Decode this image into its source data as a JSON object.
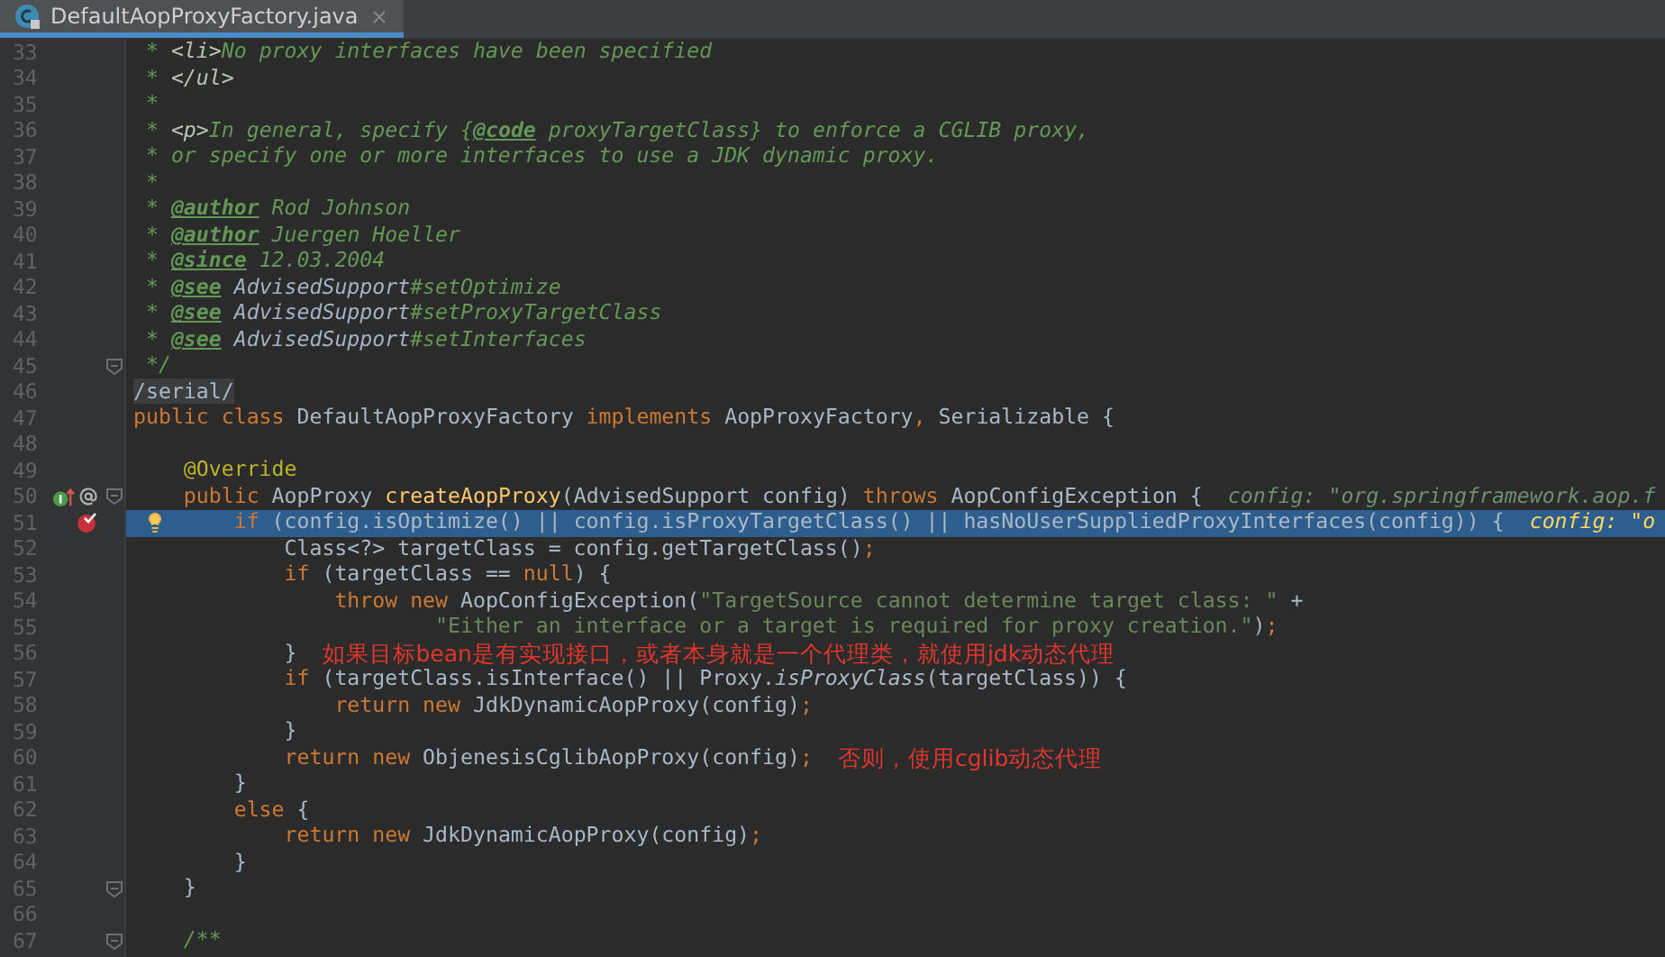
{
  "tab": {
    "title": "DefaultAopProxyFactory.java",
    "selected": true
  },
  "lines": [
    {
      "number": "33",
      "highlighted": false,
      "tokens": [
        {
          "text": " * ",
          "kind": "doc"
        },
        {
          "text": "<li>",
          "kind": "docmarkup"
        },
        {
          "text": "No proxy interfaces have been specified",
          "kind": "doc"
        }
      ]
    },
    {
      "number": "34",
      "highlighted": false,
      "tokens": [
        {
          "text": " * ",
          "kind": "doc"
        },
        {
          "text": "</ul>",
          "kind": "docmarkup"
        }
      ]
    },
    {
      "number": "35",
      "highlighted": false,
      "tokens": [
        {
          "text": " *",
          "kind": "doc"
        }
      ]
    },
    {
      "number": "36",
      "highlighted": false,
      "tokens": [
        {
          "text": " * ",
          "kind": "doc"
        },
        {
          "text": "<p>",
          "kind": "docmarkup"
        },
        {
          "text": "In general, specify {",
          "kind": "doc"
        },
        {
          "text": "@code",
          "kind": "doctag"
        },
        {
          "text": " proxyTargetClass} to enforce a CGLIB proxy,",
          "kind": "doc"
        }
      ]
    },
    {
      "number": "37",
      "highlighted": false,
      "tokens": [
        {
          "text": " * or specify one or more interfaces to use a JDK dynamic proxy.",
          "kind": "doc"
        }
      ]
    },
    {
      "number": "38",
      "highlighted": false,
      "tokens": [
        {
          "text": " *",
          "kind": "doc"
        }
      ]
    },
    {
      "number": "39",
      "highlighted": false,
      "tokens": [
        {
          "text": " * ",
          "kind": "doc"
        },
        {
          "text": "@author",
          "kind": "doctag"
        },
        {
          "text": " Rod Johnson",
          "kind": "doc"
        }
      ]
    },
    {
      "number": "40",
      "highlighted": false,
      "tokens": [
        {
          "text": " * ",
          "kind": "doc"
        },
        {
          "text": "@author",
          "kind": "doctag"
        },
        {
          "text": " Juergen Hoeller",
          "kind": "doc"
        }
      ]
    },
    {
      "number": "41",
      "highlighted": false,
      "tokens": [
        {
          "text": " * ",
          "kind": "doc"
        },
        {
          "text": "@since",
          "kind": "doctag"
        },
        {
          "text": " 12.03.2004",
          "kind": "doc"
        }
      ]
    },
    {
      "number": "42",
      "highlighted": false,
      "tokens": [
        {
          "text": " * ",
          "kind": "doc"
        },
        {
          "text": "@see",
          "kind": "doctag"
        },
        {
          "text": " AdvisedSupport",
          "kind": "docref"
        },
        {
          "text": "#setOptimize",
          "kind": "doc"
        }
      ]
    },
    {
      "number": "43",
      "highlighted": false,
      "tokens": [
        {
          "text": " * ",
          "kind": "doc"
        },
        {
          "text": "@see",
          "kind": "doctag"
        },
        {
          "text": " AdvisedSupport",
          "kind": "docref"
        },
        {
          "text": "#setProxyTargetClass",
          "kind": "doc"
        }
      ]
    },
    {
      "number": "44",
      "highlighted": false,
      "tokens": [
        {
          "text": " * ",
          "kind": "doc"
        },
        {
          "text": "@see",
          "kind": "doctag"
        },
        {
          "text": " AdvisedSupport",
          "kind": "docref"
        },
        {
          "text": "#setInterfaces",
          "kind": "doc"
        }
      ]
    },
    {
      "number": "45",
      "highlighted": false,
      "fold": true,
      "tokens": [
        {
          "text": " */",
          "kind": "doc"
        }
      ]
    },
    {
      "number": "46",
      "highlighted": false,
      "tokens": [
        {
          "text": "/serial/",
          "kind": "marked"
        }
      ]
    },
    {
      "number": "47",
      "highlighted": false,
      "tokens": [
        {
          "text": "public class",
          "kind": "kw"
        },
        {
          "text": " DefaultAopProxyFactory ",
          "kind": "plain"
        },
        {
          "text": "implements",
          "kind": "kw"
        },
        {
          "text": " AopProxyFactory",
          "kind": "plain"
        },
        {
          "text": ",",
          "kind": "kw"
        },
        {
          "text": " Serializable {",
          "kind": "plain"
        }
      ]
    },
    {
      "number": "48",
      "highlighted": false
    },
    {
      "number": "49",
      "highlighted": false,
      "tokens": [
        {
          "text": "    @Override",
          "kind": "anno"
        }
      ]
    },
    {
      "number": "50",
      "highlighted": false,
      "fold": true,
      "gutter": [
        {
          "kind": "implements"
        },
        {
          "kind": "annotated"
        }
      ],
      "tokens": [
        {
          "text": "    public",
          "kind": "kw"
        },
        {
          "text": " AopProxy ",
          "kind": "plain"
        },
        {
          "text": "createAopProxy",
          "kind": "method"
        },
        {
          "text": "(AdvisedSupport config) ",
          "kind": "plain"
        },
        {
          "text": "throws",
          "kind": "kw"
        },
        {
          "text": " AopConfigException {",
          "kind": "plain"
        }
      ],
      "hint": "config: \"org.springframework.aop.f"
    },
    {
      "number": "51",
      "highlighted": true,
      "intention_bulb": true,
      "gutter": [
        {
          "kind": "breakpoint"
        }
      ],
      "tokens": [
        {
          "text": "        if",
          "kind": "kw"
        },
        {
          "text": " (config.isOptimize() || config.isProxyTargetClass() || hasNoUserSuppliedProxyInterfaces(config)) {",
          "kind": "plain"
        }
      ],
      "hint": "config: \"o"
    },
    {
      "number": "52",
      "highlighted": false,
      "tokens": [
        {
          "text": "            Class<?> targetClass = config.getTargetClass()",
          "kind": "plain"
        },
        {
          "text": ";",
          "kind": "kw"
        }
      ]
    },
    {
      "number": "53",
      "highlighted": false,
      "tokens": [
        {
          "text": "            if",
          "kind": "kw"
        },
        {
          "text": " (targetClass == ",
          "kind": "plain"
        },
        {
          "text": "null",
          "kind": "kw"
        },
        {
          "text": ") {",
          "kind": "plain"
        }
      ]
    },
    {
      "number": "54",
      "highlighted": false,
      "tokens": [
        {
          "text": "                throw new",
          "kind": "kw"
        },
        {
          "text": " AopConfigException(",
          "kind": "plain"
        },
        {
          "text": "\"TargetSource cannot determine target class: \"",
          "kind": "str"
        },
        {
          "text": " +",
          "kind": "plain"
        }
      ]
    },
    {
      "number": "55",
      "highlighted": false,
      "tokens": [
        {
          "text": "                        \"Either an interface or a target is required for proxy creation.\"",
          "kind": "str"
        },
        {
          "text": ")",
          "kind": "plain"
        },
        {
          "text": ";",
          "kind": "kw"
        }
      ]
    },
    {
      "number": "56",
      "highlighted": false,
      "tokens": [
        {
          "text": "            }",
          "kind": "plain"
        }
      ],
      "note": "如果目标bean是有实现接口，或者本身就是一个代理类，就使用jdk动态代理"
    },
    {
      "number": "57",
      "highlighted": false,
      "tokens": [
        {
          "text": "            if",
          "kind": "kw"
        },
        {
          "text": " (targetClass.isInterface() || Proxy.",
          "kind": "plain"
        },
        {
          "text": "isProxyClass",
          "kind": "static"
        },
        {
          "text": "(targetClass)) {",
          "kind": "plain"
        }
      ]
    },
    {
      "number": "58",
      "highlighted": false,
      "tokens": [
        {
          "text": "                return new",
          "kind": "kw"
        },
        {
          "text": " JdkDynamicAopProxy(config)",
          "kind": "plain"
        },
        {
          "text": ";",
          "kind": "kw"
        }
      ]
    },
    {
      "number": "59",
      "highlighted": false,
      "tokens": [
        {
          "text": "            }",
          "kind": "plain"
        }
      ]
    },
    {
      "number": "60",
      "highlighted": false,
      "tokens": [
        {
          "text": "            return new",
          "kind": "kw"
        },
        {
          "text": " ObjenesisCglibAopProxy(config)",
          "kind": "plain"
        },
        {
          "text": ";",
          "kind": "kw"
        }
      ],
      "note": "否则，使用cglib动态代理"
    },
    {
      "number": "61",
      "highlighted": false,
      "tokens": [
        {
          "text": "        }",
          "kind": "plain"
        }
      ]
    },
    {
      "number": "62",
      "highlighted": false,
      "tokens": [
        {
          "text": "        else",
          "kind": "kw"
        },
        {
          "text": " {",
          "kind": "plain"
        }
      ]
    },
    {
      "number": "63",
      "highlighted": false,
      "tokens": [
        {
          "text": "            return new",
          "kind": "kw"
        },
        {
          "text": " JdkDynamicAopProxy(config)",
          "kind": "plain"
        },
        {
          "text": ";",
          "kind": "kw"
        }
      ]
    },
    {
      "number": "64",
      "highlighted": false,
      "tokens": [
        {
          "text": "        }",
          "kind": "plain"
        }
      ]
    },
    {
      "number": "65",
      "highlighted": false,
      "fold": true,
      "tokens": [
        {
          "text": "    }",
          "kind": "plain"
        }
      ]
    },
    {
      "number": "66",
      "highlighted": false
    },
    {
      "number": "67",
      "highlighted": false,
      "fold": true,
      "tokens": [
        {
          "text": "    /**",
          "kind": "doc"
        }
      ]
    }
  ]
}
